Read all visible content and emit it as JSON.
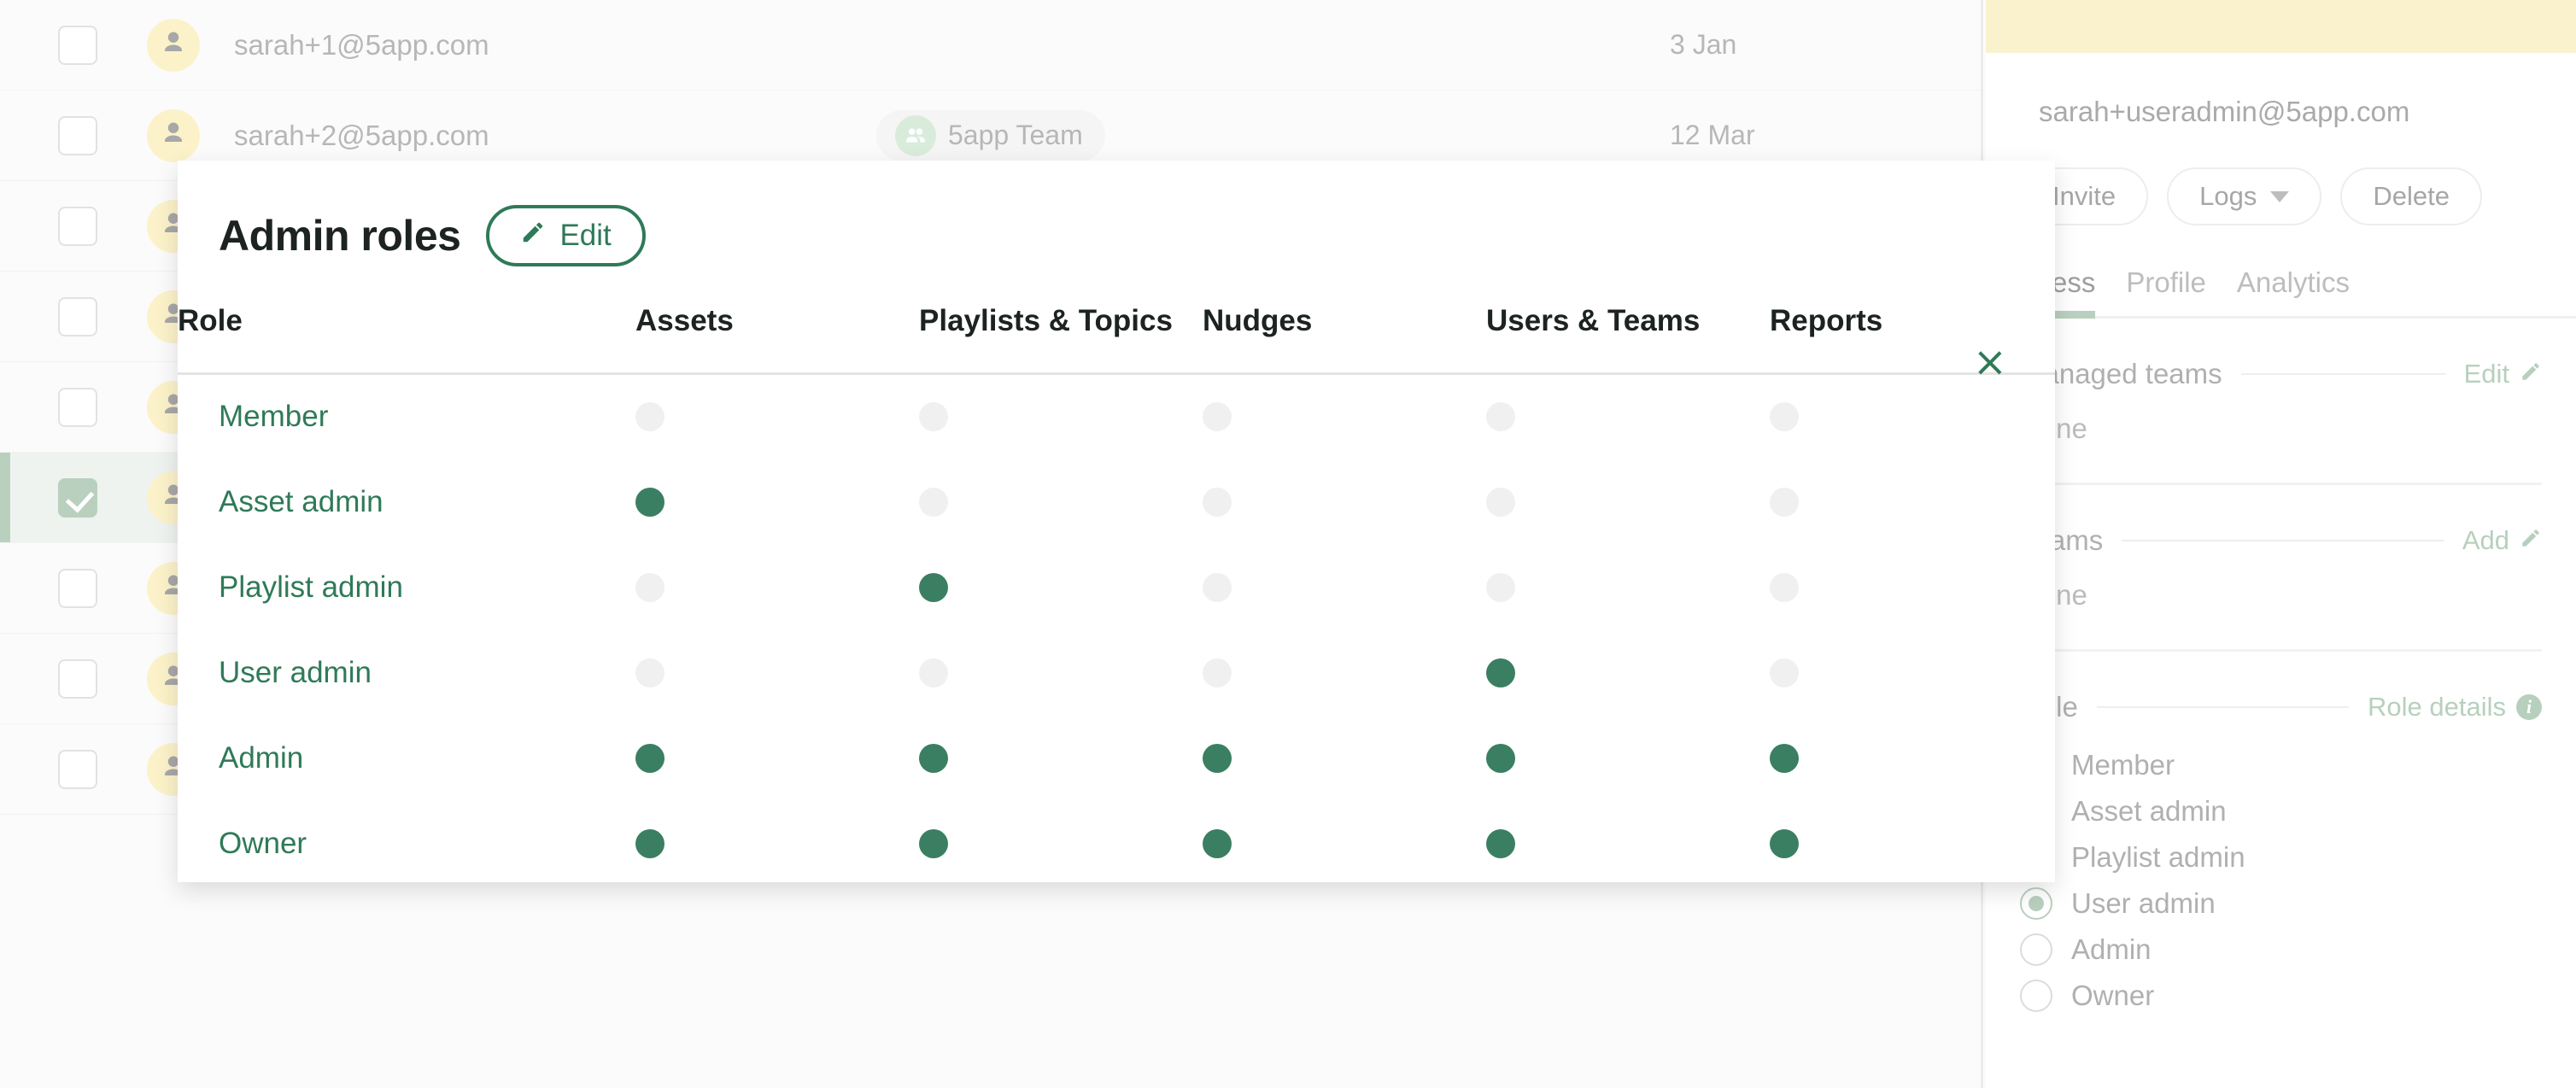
{
  "user_list": {
    "rows": [
      {
        "email": "sarah+1@5app.com",
        "team": "",
        "date": "3 Jan",
        "checked": false,
        "selected": false
      },
      {
        "email": "sarah+2@5app.com",
        "team": "5app Team",
        "date": "12 Mar",
        "checked": false,
        "selected": false
      },
      {
        "email": "",
        "team": "",
        "date": "",
        "checked": false,
        "selected": false
      },
      {
        "email": "",
        "team": "",
        "date": "",
        "checked": false,
        "selected": false
      },
      {
        "email": "",
        "team": "",
        "date": "",
        "checked": false,
        "selected": false
      },
      {
        "email": "",
        "team": "",
        "date": "",
        "checked": true,
        "selected": true
      },
      {
        "email": "",
        "team": "",
        "date": "",
        "checked": false,
        "selected": false
      },
      {
        "email": "",
        "team": "",
        "date": "",
        "checked": false,
        "selected": false
      },
      {
        "email": "",
        "team": "",
        "date": "",
        "checked": false,
        "selected": false
      }
    ]
  },
  "detail": {
    "email": "sarah+useradmin@5app.com",
    "actions": [
      {
        "label": "Invite",
        "caret": false
      },
      {
        "label": "Logs",
        "caret": true
      },
      {
        "label": "Delete",
        "caret": false
      }
    ],
    "tabs": [
      {
        "label": "Access",
        "active": true
      },
      {
        "label": "Profile",
        "active": false
      },
      {
        "label": "Analytics",
        "active": false
      }
    ],
    "sections": [
      {
        "label": "Managed teams",
        "action": "Edit",
        "action_icon": "pencil-icon",
        "value": "None"
      },
      {
        "label": "Teams",
        "action": "Add",
        "action_icon": "pencil-icon",
        "value": "None"
      }
    ],
    "role_section": {
      "label": "Role",
      "action": "Role details",
      "action_icon": "info-icon",
      "options": [
        {
          "label": "Member",
          "selected": false
        },
        {
          "label": "Asset admin",
          "selected": false
        },
        {
          "label": "Playlist admin",
          "selected": false
        },
        {
          "label": "User admin",
          "selected": true
        },
        {
          "label": "Admin",
          "selected": false
        },
        {
          "label": "Owner",
          "selected": false
        }
      ]
    }
  },
  "modal": {
    "title": "Admin roles",
    "edit_label": "Edit",
    "edit_icon": "pencil-icon",
    "close_icon": "close-icon",
    "close_label": "×",
    "columns": [
      "Role",
      "Assets",
      "Playlists & Topics",
      "Nudges",
      "Users & Teams",
      "Reports"
    ],
    "rows": [
      {
        "role": "Member",
        "assets": false,
        "playlists": false,
        "nudges": false,
        "users": false,
        "reports": false
      },
      {
        "role": "Asset admin",
        "assets": true,
        "playlists": false,
        "nudges": false,
        "users": false,
        "reports": false
      },
      {
        "role": "Playlist admin",
        "assets": false,
        "playlists": true,
        "nudges": false,
        "users": false,
        "reports": false
      },
      {
        "role": "User admin",
        "assets": false,
        "playlists": false,
        "nudges": false,
        "users": true,
        "reports": false
      },
      {
        "role": "Admin",
        "assets": true,
        "playlists": true,
        "nudges": true,
        "users": true,
        "reports": true
      },
      {
        "role": "Owner",
        "assets": true,
        "playlists": true,
        "nudges": true,
        "users": true,
        "reports": true
      }
    ]
  },
  "colors": {
    "accent_green": "#2f7a58",
    "dot_on": "#3b7f62",
    "dot_off": "#f0f0f0",
    "muted_green": "#b9d0bf",
    "avatar_yellow": "#fcf2c9",
    "banner_yellow": "#faf2cd",
    "text_muted": "#b7b7b7"
  }
}
